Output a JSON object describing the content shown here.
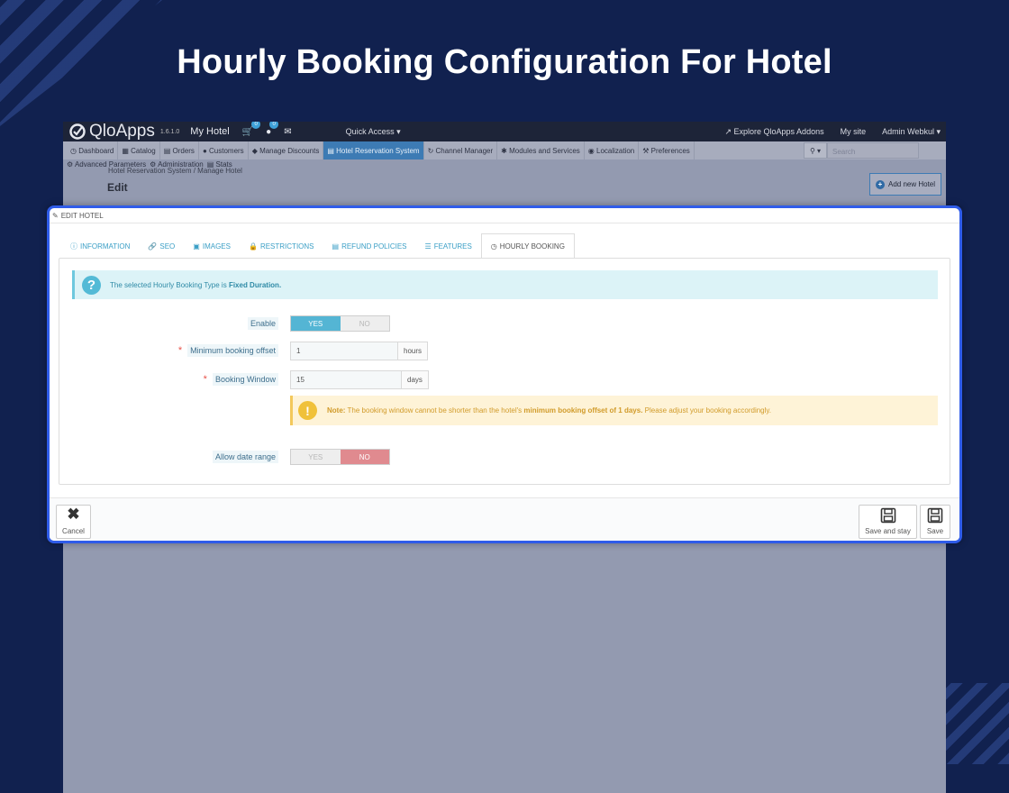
{
  "hero": {
    "title": "Hourly Booking Configuration For Hotel"
  },
  "topbar": {
    "logo": "QloApps",
    "version": "1.6.1.0",
    "shop_name": "My Hotel",
    "cart_badge": "0",
    "customer_badge": "0",
    "quick_access": "Quick Access",
    "explore": "Explore QloApps Addons",
    "my_site": "My site",
    "admin": "Admin Webkul"
  },
  "menu": {
    "items": [
      "Dashboard",
      "Catalog",
      "Orders",
      "Customers",
      "Manage Discounts",
      "Hotel Reservation System",
      "Channel Manager",
      "Modules and Services",
      "Localization",
      "Preferences"
    ],
    "row2": [
      "Advanced Parameters",
      "Administration",
      "Stats"
    ],
    "search_placeholder": "Search"
  },
  "page": {
    "breadcrumb": "Hotel Reservation System  /  Manage Hotel",
    "title": "Edit",
    "add_new": "Add new Hotel"
  },
  "panel": {
    "heading": "EDIT HOTEL",
    "tabs": [
      "INFORMATION",
      "SEO",
      "IMAGES",
      "RESTRICTIONS",
      "REFUND POLICIES",
      "FEATURES",
      "HOURLY BOOKING"
    ],
    "active_tab": "HOURLY BOOKING",
    "info_prefix": "The selected Hourly Booking Type is ",
    "info_value": "Fixed Duration.",
    "enable_label": "Enable",
    "yes": "YES",
    "no": "NO",
    "enable_value": "YES",
    "min_offset_label": "Minimum booking offset",
    "min_offset_value": "1",
    "min_offset_unit": "hours",
    "window_label": "Booking Window",
    "window_value": "15",
    "window_unit": "days",
    "note_label": "Note:",
    "note_text": " The booking window cannot be shorter than the hotel's ",
    "note_bold": "minimum booking offset of 1 days.",
    "note_tail": " Please adjust your booking accordingly.",
    "date_range_label": "Allow date range",
    "date_range_value": "NO"
  },
  "footer": {
    "cancel": "Cancel",
    "save_stay": "Save and stay",
    "save": "Save"
  }
}
